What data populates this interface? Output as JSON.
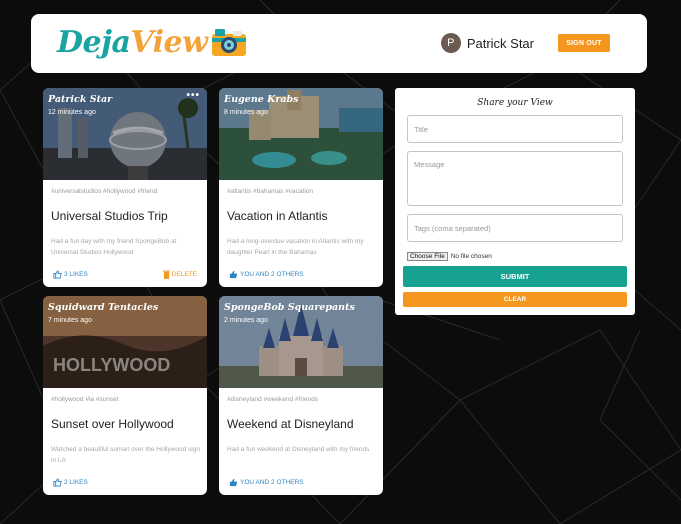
{
  "header": {
    "brand_part1": "Deja",
    "brand_part2": "View",
    "user_initial": "P",
    "user_name": "Patrick Star",
    "signout_label": "SIGN OUT"
  },
  "colors": {
    "teal": "#19a3a3",
    "orange": "#f5961f",
    "submit": "#17a191",
    "like_blue": "#2e86c1"
  },
  "posts": [
    {
      "author": "Patrick Star",
      "time": "12 minutes ago",
      "more": "•••",
      "tags": "#universalstudios #hollywood #friend",
      "title": "Universal Studios Trip",
      "message": "Had a fun day with my friend SpongeBob at Universal Studios Hollywood",
      "likes": "3 LIKES",
      "delete_label": "DELETE",
      "like_icon": "thumb-up-outline-icon"
    },
    {
      "author": "Eugene Krabs",
      "time": "8 minutes ago",
      "tags": "#atlantis #bahamas #vacation",
      "title": "Vacation in Atlantis",
      "message": "Had a long-overdue vacation in Atlantis with my daughter Pearl in the Bahamas",
      "likes": "YOU AND 2 OTHERS",
      "like_icon": "thumb-up-filled-icon"
    },
    {
      "author": "Squidward Tentacles",
      "time": "7 minutes ago",
      "tags": "#hollywood #la #sunset",
      "title": "Sunset over Hollywood",
      "message": "Watched a beautiful sunset over the Hollywood sign in LA",
      "likes": "2 LIKES",
      "like_icon": "thumb-up-outline-icon"
    },
    {
      "author": "SpongeBob Squarepants",
      "time": "2 minutes ago",
      "tags": "#disneyland #weekend #friends",
      "title": "Weekend at Disneyland",
      "message": "Had a fun weekend at Disneyland with my friends",
      "likes": "YOU AND 2 OTHERS",
      "like_icon": "thumb-up-filled-icon"
    }
  ],
  "form": {
    "heading": "Share your View",
    "title_placeholder": "Title",
    "message_placeholder": "Message",
    "tags_placeholder": "Tags (coma separated)",
    "file_button": "Choose File",
    "file_status": "No file chosen",
    "submit_label": "SUBMIT",
    "clear_label": "CLEAR"
  }
}
